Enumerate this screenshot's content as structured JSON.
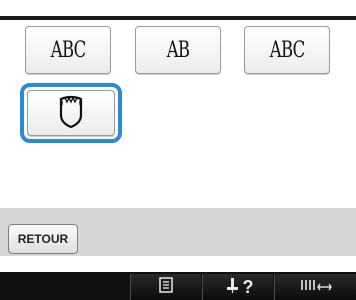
{
  "monogram_tiles": [
    {
      "label": "ABC",
      "style": "diamond-script"
    },
    {
      "label": "AB",
      "style": "diamond-two-letter"
    },
    {
      "label": "ABC",
      "style": "diamond-block"
    }
  ],
  "frame_tile": {
    "icon": "shield-frame-icon"
  },
  "retour_button": {
    "label": "RETOUR"
  },
  "toolbar": {
    "list_icon": "list-icon",
    "help_text": "?",
    "help_icon": "needle-help-icon",
    "thread_icon": "thread-spacing-icon"
  },
  "colors": {
    "selection": "#2b8ad8",
    "toolbar": "#111111",
    "strip": "#d6d6d6"
  }
}
